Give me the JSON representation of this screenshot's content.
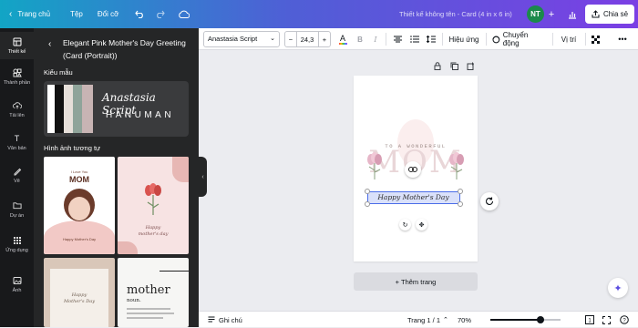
{
  "topbar": {
    "back_label": "Trang chủ",
    "file_label": "Tệp",
    "resize_label": "Đổi cỡ",
    "doc_title": "Thiết kế không tên - Card (4 in x 6 in)",
    "avatar_initials": "NT",
    "share_label": "Chia sẻ"
  },
  "rail": {
    "items": [
      {
        "label": "Thiết kế",
        "icon": "layout-icon"
      },
      {
        "label": "Thành phần",
        "icon": "shapes-icon"
      },
      {
        "label": "Tải lên",
        "icon": "cloud-upload-icon"
      },
      {
        "label": "Văn bản",
        "icon": "text-icon"
      },
      {
        "label": "Vẽ",
        "icon": "pen-icon"
      },
      {
        "label": "Dự án",
        "icon": "folder-icon"
      },
      {
        "label": "Ứng dụng",
        "icon": "apps-grid-icon"
      },
      {
        "label": "Ảnh",
        "icon": "image-icon"
      }
    ]
  },
  "panel": {
    "title": "Elegant Pink Mother's Day Greeting (Card (Portrait))",
    "styles_label": "Kiểu mẫu",
    "style_font_1": "Anastasia Script",
    "style_font_2": "HANUMAN",
    "similar_label": "Hình ảnh tương tự",
    "thumbs": [
      {
        "line1": "I Love You",
        "line2": "MOM",
        "line3": "Happy Mother's Day"
      },
      {
        "line1": "Happy",
        "line2": "mother's day"
      },
      {
        "line1": "Happy",
        "line2": "Mother's Day"
      },
      {
        "line1": "mother",
        "line2": "noun."
      }
    ]
  },
  "toolbar": {
    "font_name": "Anastasia Script",
    "font_size": "24,3",
    "effects_label": "Hiệu ứng",
    "animate_label": "Chuyển động",
    "position_label": "Vị trí"
  },
  "card": {
    "subtitle": "TO A WONDERFUL",
    "main": "MOM",
    "greeting": "Happy Mother's Day"
  },
  "canvas": {
    "add_page_label": "+ Thêm trang"
  },
  "bottombar": {
    "notes_label": "Ghi chú",
    "page_label": "Trang 1 / 1",
    "zoom": "70%",
    "zoom_level": 0.72
  },
  "colors": {
    "accent": "#7b3fe4",
    "pink": "#f3d6dc",
    "selection": "#4b6de8"
  }
}
